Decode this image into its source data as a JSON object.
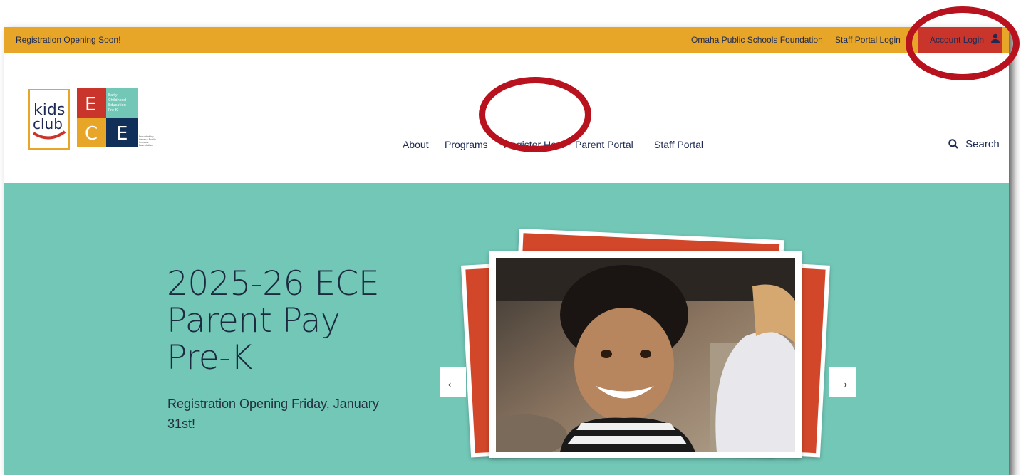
{
  "topbar": {
    "announcement": "Registration Opening Soon!",
    "links": [
      "Omaha Public Schools Foundation",
      "Staff Portal Login"
    ],
    "account_login": "Account Login",
    "account_icon": "user-icon"
  },
  "logo": {
    "kids_club": "kids club",
    "tiles": [
      "E",
      "C",
      "E"
    ],
    "tile_caption": "Early Childhood Education Pre-K",
    "provided_by": "Provided by Omaha Public Schools Foundation"
  },
  "nav": {
    "items": [
      "About",
      "Programs",
      "Register Here",
      "Parent Portal",
      "Staff Portal"
    ],
    "search_label": "Search",
    "search_icon": "search-icon"
  },
  "hero": {
    "title_lines": [
      "2025-26 ECE",
      "Parent Pay",
      "Pre-K"
    ],
    "subtitle": "Registration Opening Friday, January 31st!",
    "prev_arrow": "←",
    "next_arrow": "→"
  },
  "colors": {
    "topbar": "#e8a628",
    "account_bg": "#c9352b",
    "hero_bg": "#72c7b7",
    "card_red": "#d2472a",
    "annotation": "#b7121e"
  }
}
